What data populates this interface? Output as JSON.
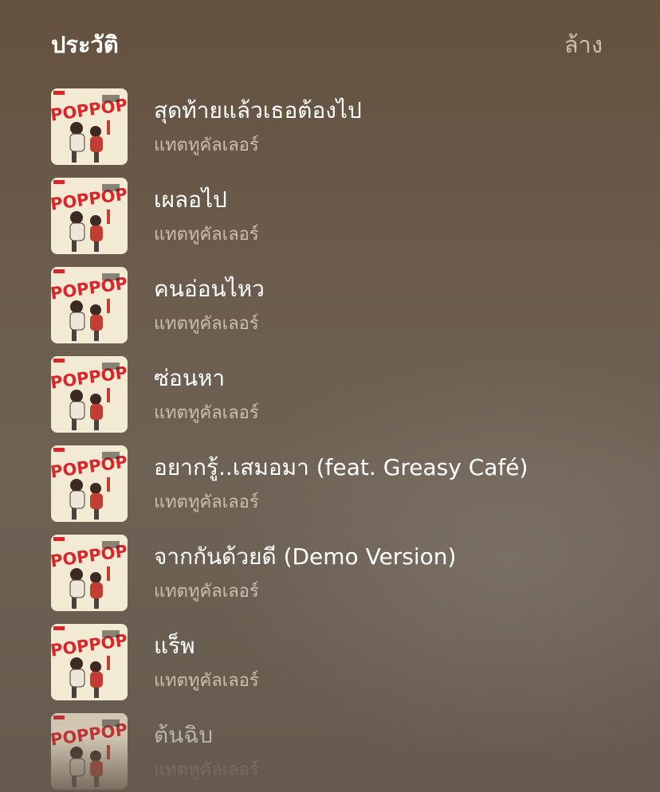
{
  "header": {
    "title": "ประวัติ",
    "clear_label": "ล้าง"
  },
  "history": [
    {
      "song": "สุดท้ายแล้วเธอต้องไป",
      "artist": "แทตทูคัลเลอร์",
      "artwork_icon": "album-cover-pop-pop"
    },
    {
      "song": "เผลอไป",
      "artist": "แทตทูคัลเลอร์",
      "artwork_icon": "album-cover-pop-pop"
    },
    {
      "song": "คนอ่อนไหว",
      "artist": "แทตทูคัลเลอร์",
      "artwork_icon": "album-cover-pop-pop"
    },
    {
      "song": "ซ่อนหา",
      "artist": "แทตทูคัลเลอร์",
      "artwork_icon": "album-cover-pop-pop"
    },
    {
      "song": "อยากรู้..เสมอมา (feat. Greasy Café)",
      "artist": "แทตทูคัลเลอร์",
      "artwork_icon": "album-cover-pop-pop"
    },
    {
      "song": "จากกันด้วยดี (Demo Version)",
      "artist": "แทตทูคัลเลอร์",
      "artwork_icon": "album-cover-pop-pop"
    },
    {
      "song": "แร็พ",
      "artist": "แทตทูคัลเลอร์",
      "artwork_icon": "album-cover-pop-pop"
    },
    {
      "song": "ต้นฉิบ",
      "artist": "แทตทูคัลเลอร์",
      "artwork_icon": "album-cover-pop-pop"
    }
  ],
  "album_art_text": "POPPOP",
  "colors": {
    "background": "#6b5c4d",
    "title": "#ffffff",
    "secondary_text": "#cbbdaf",
    "art_background": "#f3ead3",
    "art_logo": "#d8262a"
  }
}
